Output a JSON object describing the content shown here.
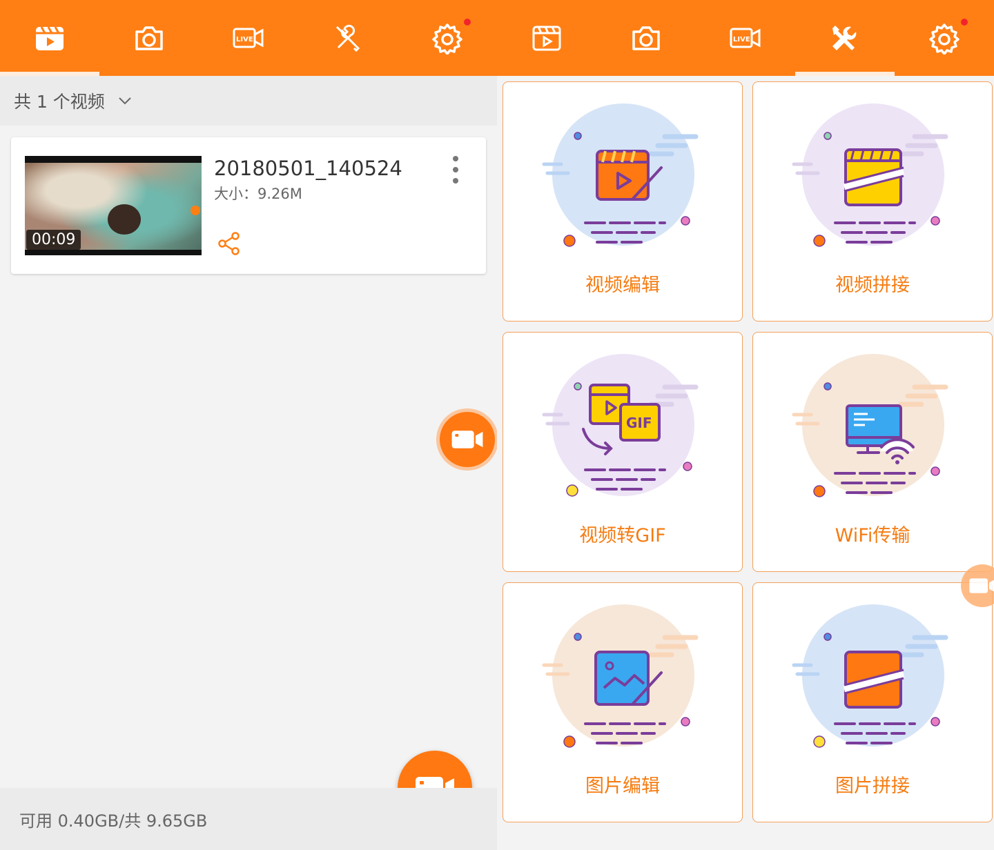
{
  "left_panel": {
    "tabs": [
      {
        "icon": "video-library-icon",
        "active": true
      },
      {
        "icon": "camera-icon"
      },
      {
        "icon": "live-stream-icon"
      },
      {
        "icon": "tools-icon"
      },
      {
        "icon": "settings-icon",
        "has_notification": true
      }
    ],
    "summary": "共 1 个视频",
    "video": {
      "title": "20180501_140524",
      "size": "大小：9.26M",
      "duration": "00:09"
    },
    "storage": "可用 0.40GB/共 9.65GB"
  },
  "right_panel": {
    "tabs": [
      {
        "icon": "video-library-icon"
      },
      {
        "icon": "camera-icon"
      },
      {
        "icon": "live-stream-icon"
      },
      {
        "icon": "tools-icon",
        "active": true
      },
      {
        "icon": "settings-icon",
        "has_notification": true
      }
    ],
    "tools": [
      {
        "label": "视频编辑",
        "icon": "video-edit-icon",
        "circle_color": "#d6e4f7"
      },
      {
        "label": "视频拼接",
        "icon": "video-merge-icon",
        "circle_color": "#ede4f6"
      },
      {
        "label": "视频转GIF",
        "icon": "video-to-gif-icon",
        "circle_color": "#ede4f6"
      },
      {
        "label": "WiFi传输",
        "icon": "wifi-transfer-icon",
        "circle_color": "#f6e7d9"
      },
      {
        "label": "图片编辑",
        "icon": "image-edit-icon",
        "circle_color": "#f6e7d9"
      },
      {
        "label": "图片拼接",
        "icon": "image-merge-icon",
        "circle_color": "#d6e4f7"
      }
    ]
  },
  "colors": {
    "accent": "#ff7f14",
    "notification": "#f2242b",
    "outline_purple": "#7a3d9a",
    "label_orange": "#f57c12"
  }
}
